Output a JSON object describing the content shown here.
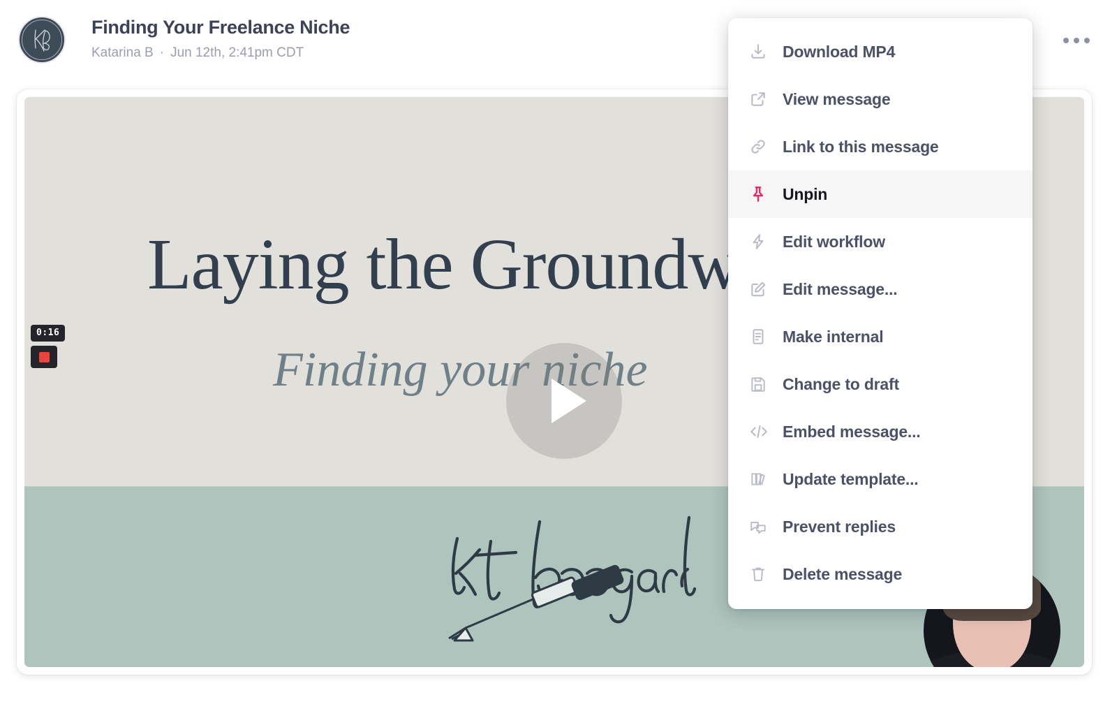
{
  "header": {
    "avatar_initials": "KB",
    "avatar_name": "kb-monogram-logo",
    "title": "Finding Your Freelance Niche",
    "author": "Katarina B",
    "separator": "·",
    "timestamp": "Jun 12th, 2:41pm CDT",
    "kebab_label": "•••"
  },
  "video": {
    "duration": "0:16",
    "record_button_name": "stop-record-button",
    "play_button_name": "play-button",
    "slide": {
      "headline": "Laying the Groundwork",
      "subheadline": "Finding your niche",
      "signature": "kat boogaard"
    },
    "colors": {
      "slide_top_bg": "#e2e0db",
      "slide_bottom_bg": "#aec4bc",
      "headline_color": "#313f4e",
      "subheadline_color": "#6f8089"
    }
  },
  "menu": {
    "highlight_color": "#f6f6f6",
    "accent_color": "#f5215c",
    "items": [
      {
        "label": "Download MP4",
        "icon": "download-icon",
        "active": false
      },
      {
        "label": "View message",
        "icon": "external-link-icon",
        "active": false
      },
      {
        "label": "Link to this message",
        "icon": "link-icon",
        "active": false
      },
      {
        "label": "Unpin",
        "icon": "pin-icon",
        "active": true
      },
      {
        "label": "Edit workflow",
        "icon": "lightning-bolt-icon",
        "active": false
      },
      {
        "label": "Edit message...",
        "icon": "pencil-square-icon",
        "active": false
      },
      {
        "label": "Make internal",
        "icon": "document-icon",
        "active": false
      },
      {
        "label": "Change to draft",
        "icon": "floppy-disk-icon",
        "active": false
      },
      {
        "label": "Embed message...",
        "icon": "code-icon",
        "active": false
      },
      {
        "label": "Update template...",
        "icon": "books-icon",
        "active": false
      },
      {
        "label": "Prevent replies",
        "icon": "chat-bubbles-icon",
        "active": false
      },
      {
        "label": "Delete message",
        "icon": "trash-icon",
        "active": false
      }
    ]
  }
}
